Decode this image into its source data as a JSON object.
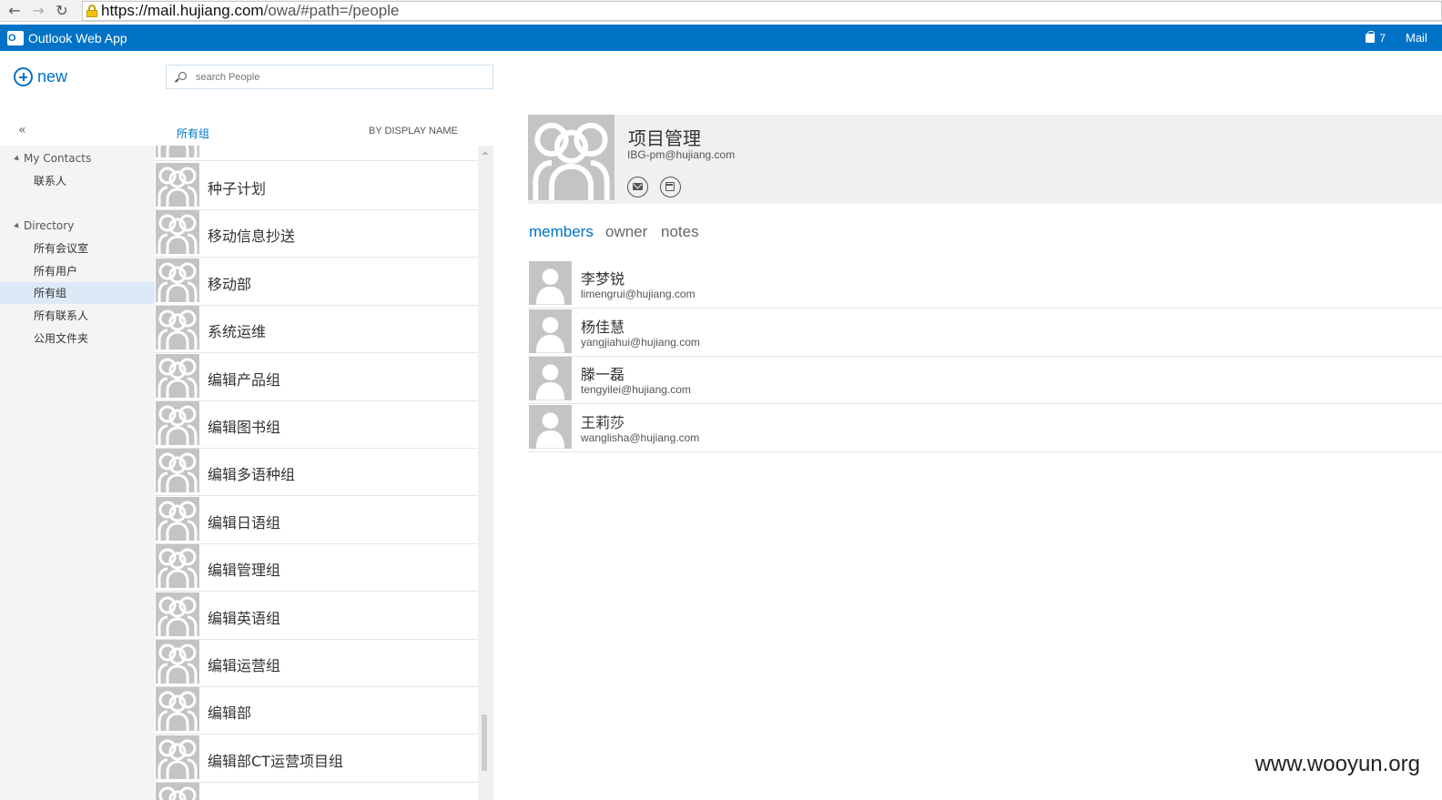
{
  "browser": {
    "url_host": "https://mail.hujiang.com",
    "url_path": "/owa/#path=/people"
  },
  "app": {
    "title": "Outlook Web App",
    "logo_text": "O",
    "notification_count": "7",
    "mail_link": "Mail"
  },
  "toolbar": {
    "new_label": "new",
    "collapse_label": "«"
  },
  "search": {
    "placeholder": "search People"
  },
  "nav": {
    "my_contacts": {
      "label": "My Contacts",
      "items": [
        "联系人"
      ]
    },
    "directory": {
      "label": "Directory",
      "items": [
        "所有会议室",
        "所有用户",
        "所有组",
        "所有联系人",
        "公用文件夹"
      ],
      "selected": "所有组"
    }
  },
  "list": {
    "filter_label": "所有组",
    "sort_label": "BY DISPLAY NAME",
    "items": [
      "种子计划",
      "移动信息抄送",
      "移动部",
      "系统运维",
      "编辑产品组",
      "编辑图书组",
      "编辑多语种组",
      "编辑日语组",
      "编辑管理组",
      "编辑英语组",
      "编辑运营组",
      "编辑部",
      "编辑部CT运营项目组"
    ]
  },
  "detail": {
    "name": "项目管理",
    "email": "IBG-pm@hujiang.com",
    "tabs": [
      "members",
      "owner",
      "notes"
    ],
    "active_tab": "members",
    "members": [
      {
        "name": "李梦锐",
        "email": "limengrui@hujiang.com"
      },
      {
        "name": "杨佳慧",
        "email": "yangjiahui@hujiang.com"
      },
      {
        "name": "滕一磊",
        "email": "tengyilei@hujiang.com"
      },
      {
        "name": "王莉莎",
        "email": "wanglisha@hujiang.com"
      }
    ]
  },
  "watermark": "www.wooyun.org",
  "colors": {
    "brand": "#0072c6",
    "avatar_bg": "#c4c4c4",
    "selection": "#dde9f6"
  }
}
